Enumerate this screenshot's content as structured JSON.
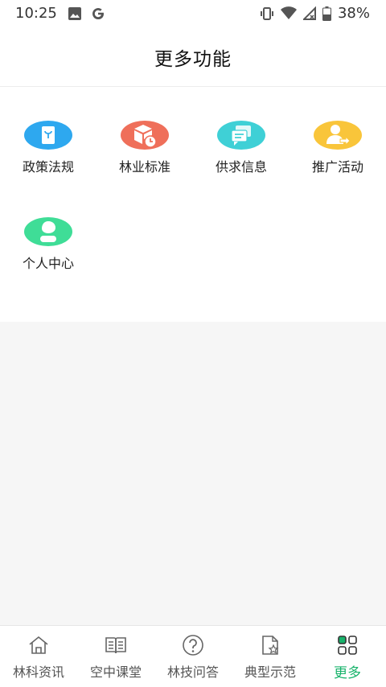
{
  "status_bar": {
    "time": "10:25",
    "battery": "38%"
  },
  "header": {
    "title": "更多功能"
  },
  "features": [
    {
      "label": "政策法规",
      "icon": "policy-book-icon",
      "color": "#2ea8ef"
    },
    {
      "label": "林业标准",
      "icon": "box-clock-icon",
      "color": "#ef6f5a"
    },
    {
      "label": "供求信息",
      "icon": "chat-bubbles-icon",
      "color": "#3fd0d6"
    },
    {
      "label": "推广活动",
      "icon": "person-share-icon",
      "color": "#f9c53a"
    },
    {
      "label": "个人中心",
      "icon": "person-leaf-icon",
      "color": "#3fdd97"
    }
  ],
  "tabs": [
    {
      "label": "林科资讯",
      "icon": "home-icon",
      "active": false
    },
    {
      "label": "空中课堂",
      "icon": "book-icon",
      "active": false
    },
    {
      "label": "林技问答",
      "icon": "question-icon",
      "active": false
    },
    {
      "label": "典型示范",
      "icon": "doc-star-icon",
      "active": false
    },
    {
      "label": "更多",
      "icon": "grid-icon",
      "active": true
    }
  ],
  "colors": {
    "accent": "#18b36b"
  }
}
